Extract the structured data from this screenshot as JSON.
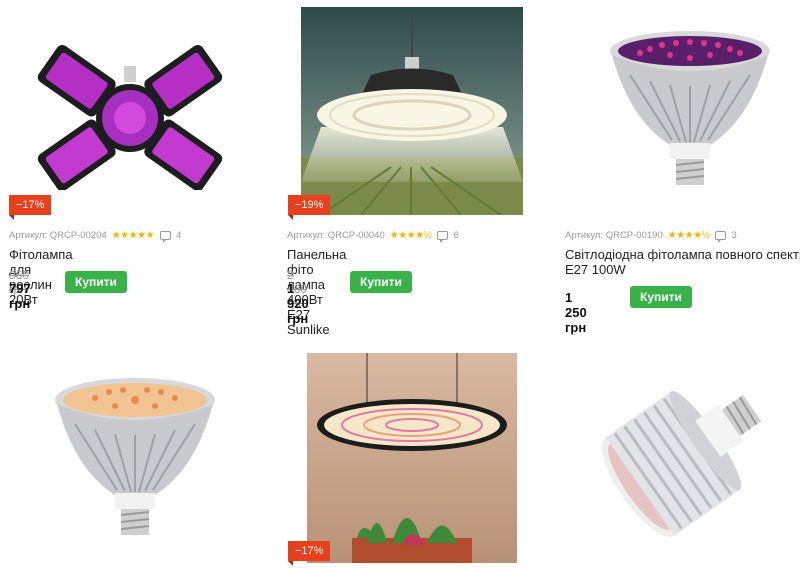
{
  "products": [
    {
      "badge": "−17%",
      "sku": "Артикул: QRCP-00204",
      "stars": "★★★★★",
      "reviews": "4",
      "title": "Фітолампа для рослин 20Вт",
      "old_price": "960 грн",
      "price": "797 грн",
      "buy_label": "Купити",
      "image_icon": "folding-four-panel-led-grow-lamp"
    },
    {
      "badge": "−19%",
      "sku": "Артикул: QRCP-00040",
      "stars": "★★★★½",
      "reviews": "6",
      "title": "Панельна фіто лампа 400Вт Е27 Sunlike",
      "old_price": "2 360 грн",
      "price": "1 920 грн",
      "buy_label": "Купити",
      "image_icon": "ufo-panel-grow-lamp-over-field"
    },
    {
      "badge": "",
      "sku": "Артикул: QRCP-00190",
      "stars": "★★★★½",
      "reviews": "3",
      "title_line1": "Світлодіодна фітолампа повного спектр",
      "title_line2": "E27 100W",
      "price": "1 250 грн",
      "buy_label": "Купити",
      "image_icon": "par-grow-bulb-purple"
    },
    {
      "image_icon": "par-grow-bulb-warm-white"
    },
    {
      "badge": "−17%",
      "image_icon": "round-hanging-grow-panel-over-plants"
    },
    {
      "image_icon": "finned-white-led-bulb"
    }
  ],
  "colors": {
    "discount_badge": "#e8401c",
    "buy_button": "#3ab24a",
    "stars": "#f4b400"
  }
}
